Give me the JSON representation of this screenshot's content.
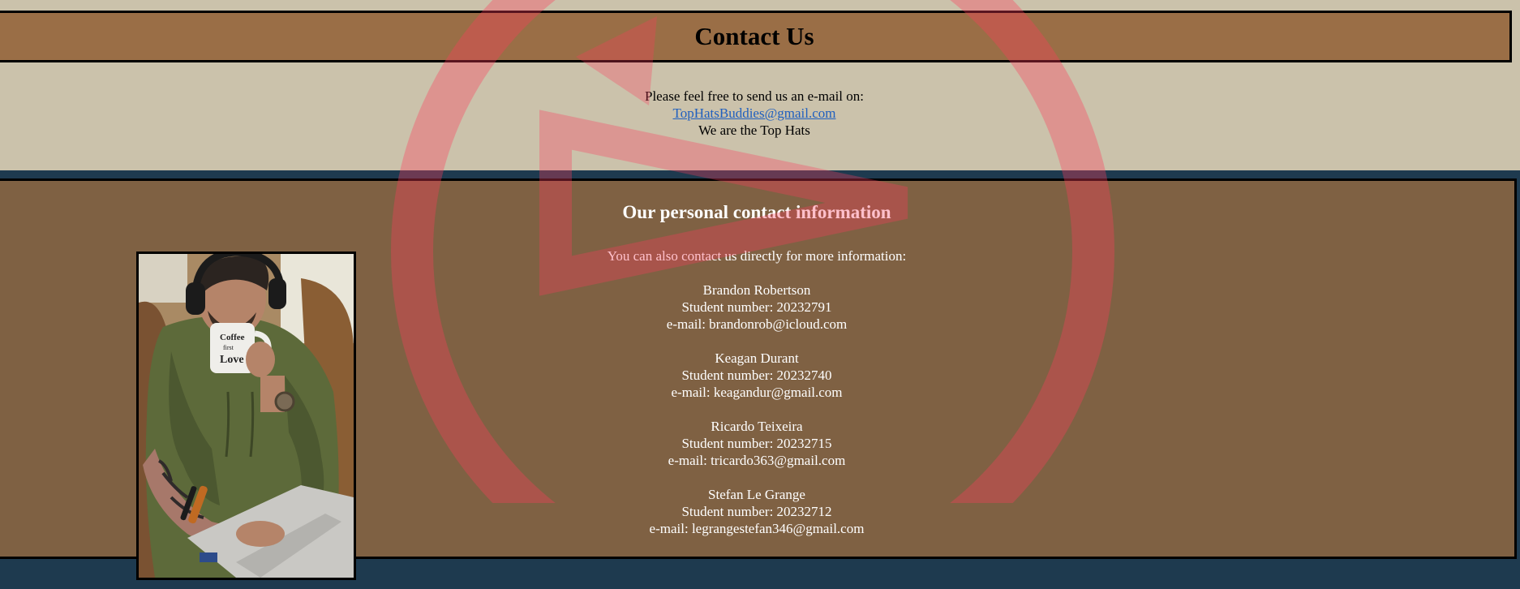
{
  "header": {
    "title": "Contact Us"
  },
  "intro": {
    "line1": "Please feel free to send us an e-mail on:",
    "email_link": "TopHatsBuddies@gmail.com",
    "line3": "We are the Top Hats"
  },
  "contact": {
    "heading": "Our personal contact information",
    "subtitle": "You can also contact us directly for more information:",
    "people": [
      {
        "name": "Brandon Robertson",
        "student_number": "Student number: 20232791",
        "email": "e-mail: brandonrob@icloud.com"
      },
      {
        "name": "Keagan Durant",
        "student_number": "Student number: 20232740",
        "email": "e-mail: keagandur@gmail.com"
      },
      {
        "name": "Ricardo Teixeira",
        "student_number": "Student number: 20232715",
        "email": "e-mail: tricardo363@gmail.com"
      },
      {
        "name": "Stefan Le Grange",
        "student_number": "Student number: 20232712",
        "email": "e-mail: legrangestefan346@gmail.com"
      }
    ]
  },
  "photo": {
    "mug_text": "Coffee first love",
    "icon": "person-with-coffee-and-laptop"
  },
  "colors": {
    "top_band": "#cbc2ab",
    "title_bar": "#9a6e46",
    "contact_section": "#7f6143",
    "footer": "#1e3a4f",
    "link": "#1f5fbf",
    "watermark": "#ff3b5c"
  }
}
